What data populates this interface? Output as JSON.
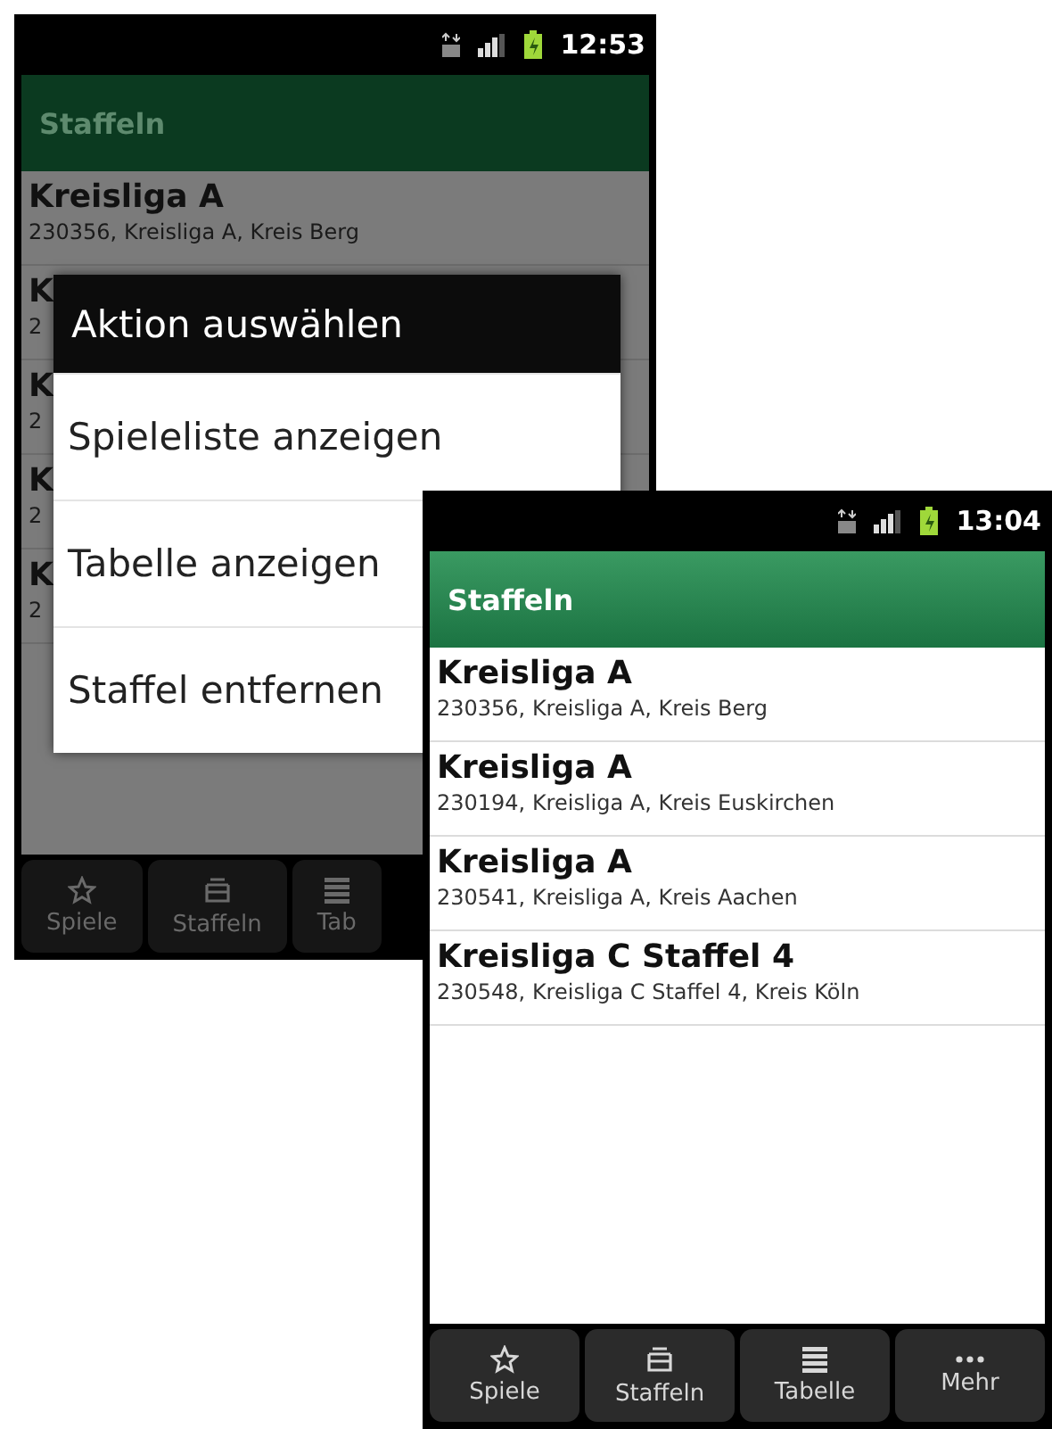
{
  "screens": [
    {
      "status_bar": {
        "time": "12:53"
      },
      "header": {
        "title": "Staffeln"
      },
      "dimmed": true,
      "rows": [
        {
          "title": "Kreisliga A",
          "subtitle": "230356, Kreisliga A, Kreis Berg"
        },
        {
          "title": "K",
          "subtitle": "2"
        },
        {
          "title": "K",
          "subtitle": "2"
        },
        {
          "title": "K",
          "subtitle": "2"
        },
        {
          "title": "K",
          "subtitle": "2"
        }
      ],
      "dialog": {
        "title": "Aktion auswählen",
        "items": [
          "Spieleliste anzeigen",
          "Tabelle anzeigen",
          "Staffel entfernen"
        ]
      },
      "tabs": [
        {
          "label": "Spiele",
          "kind": "star"
        },
        {
          "label": "Staffeln",
          "kind": "layers"
        },
        {
          "label": "Tab",
          "kind": "list"
        }
      ]
    },
    {
      "status_bar": {
        "time": "13:04"
      },
      "header": {
        "title": "Staffeln"
      },
      "dimmed": false,
      "rows": [
        {
          "title": "Kreisliga A",
          "subtitle": "230356, Kreisliga A, Kreis Berg"
        },
        {
          "title": "Kreisliga A",
          "subtitle": "230194, Kreisliga A, Kreis Euskirchen"
        },
        {
          "title": "Kreisliga A",
          "subtitle": "230541, Kreisliga A, Kreis Aachen"
        },
        {
          "title": "Kreisliga C Staffel 4",
          "subtitle": "230548, Kreisliga C Staffel 4, Kreis Köln"
        }
      ],
      "tabs": [
        {
          "label": "Spiele",
          "kind": "star"
        },
        {
          "label": "Staffeln",
          "kind": "layers"
        },
        {
          "label": "Tabelle",
          "kind": "list"
        },
        {
          "label": "Mehr",
          "kind": "more"
        }
      ]
    }
  ]
}
